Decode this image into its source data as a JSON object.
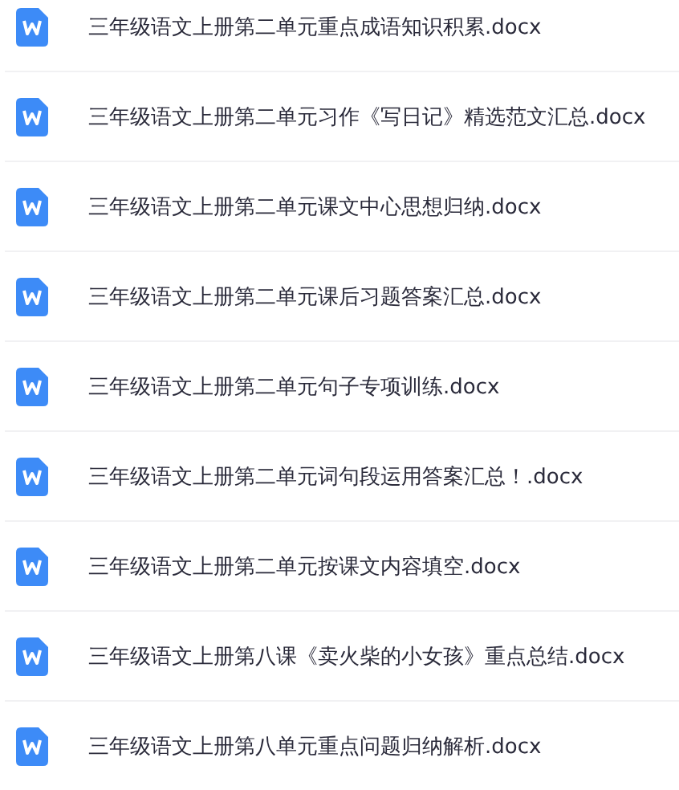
{
  "files": [
    {
      "name": "三年级语文上册第二单元重点成语知识积累.docx"
    },
    {
      "name": "三年级语文上册第二单元习作《写日记》精选范文汇总.docx"
    },
    {
      "name": "三年级语文上册第二单元课文中心思想归纳.docx"
    },
    {
      "name": "三年级语文上册第二单元课后习题答案汇总.docx"
    },
    {
      "name": "三年级语文上册第二单元句子专项训练.docx"
    },
    {
      "name": "三年级语文上册第二单元词句段运用答案汇总！.docx"
    },
    {
      "name": "三年级语文上册第二单元按课文内容填空.docx"
    },
    {
      "name": "三年级语文上册第八课《卖火柴的小女孩》重点总结.docx"
    },
    {
      "name": "三年级语文上册第八单元重点问题归纳解析.docx"
    }
  ]
}
